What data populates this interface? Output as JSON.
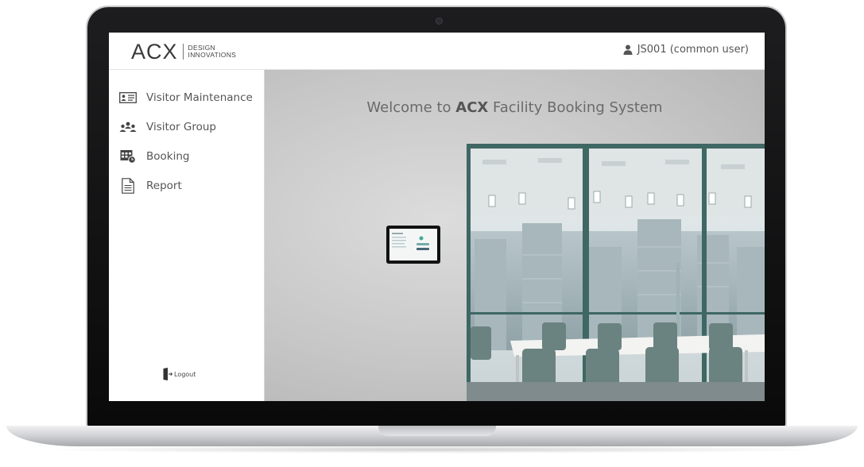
{
  "header": {
    "logo": {
      "mark": "ACX",
      "sub_line1": "DESIGN",
      "sub_line2": "INNOVATIONS"
    },
    "user": {
      "icon": "user-icon",
      "label": "JS001 (common user)"
    }
  },
  "sidebar": {
    "items": [
      {
        "icon": "id-card-icon",
        "label": "Visitor Maintenance"
      },
      {
        "icon": "group-icon",
        "label": "Visitor Group"
      },
      {
        "icon": "calendar-clock-icon",
        "label": "Booking"
      },
      {
        "icon": "document-icon",
        "label": "Report"
      }
    ],
    "logout": {
      "icon": "logout-door-icon",
      "label": "Logout"
    }
  },
  "main": {
    "welcome_prefix": "Welcome to",
    "welcome_brand": "ACX",
    "welcome_suffix": "Facility Booking System"
  },
  "colors": {
    "text": "#555555",
    "background": "#c7c7c7",
    "glass_frame": "#3f6763"
  }
}
